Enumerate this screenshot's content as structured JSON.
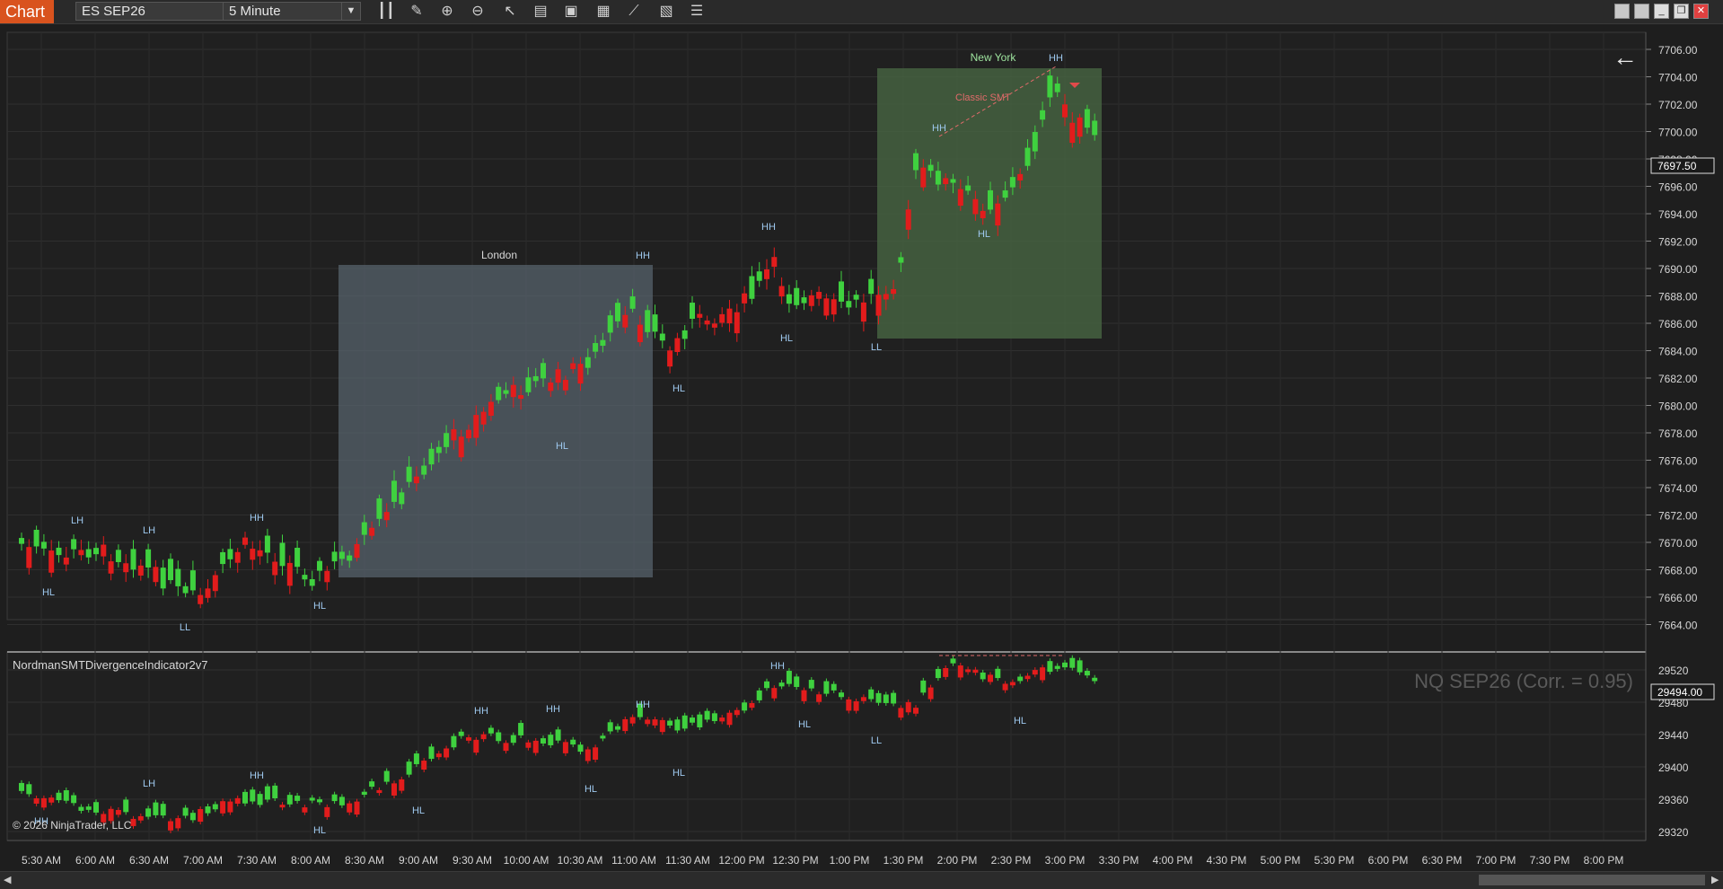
{
  "toolbar": {
    "tab_label": "Chart",
    "instrument": "ES SEP26",
    "interval": "5 Minute",
    "tools": [
      "bar-chart-icon",
      "pencil-icon",
      "zoom-in-icon",
      "zoom-out-icon",
      "pointer-icon",
      "properties-icon",
      "template-icon",
      "strategies-icon",
      "indicators-icon",
      "data-box-icon",
      "menu-icon"
    ],
    "window_buttons": [
      "▫",
      "▫",
      "_",
      "❐",
      "✕"
    ]
  },
  "main_panel": {
    "price_axis": [
      "7706.00",
      "7704.00",
      "7702.00",
      "7700.00",
      "7698.00",
      "7696.00",
      "7694.00",
      "7692.00",
      "7690.00",
      "7688.00",
      "7686.00",
      "7684.00",
      "7682.00",
      "7680.00",
      "7678.00",
      "7676.00",
      "7674.00",
      "7672.00",
      "7670.00",
      "7668.00",
      "7666.00",
      "7664.00"
    ],
    "current_price": "7697.50",
    "sessions": {
      "london": "London",
      "new_york": "New York"
    },
    "annotation": "Classic SMT",
    "swing_labels": [
      "LH",
      "HL",
      "LH",
      "LL",
      "HH",
      "HL",
      "HH",
      "HL",
      "HL",
      "HH",
      "HL",
      "LL",
      "HH",
      "HL",
      "HH"
    ]
  },
  "indicator_panel": {
    "name": "NordmanSMTDivergenceIndicator2v7",
    "correlation": "NQ SEP26 (Corr. = 0.95)",
    "price_axis": [
      "29520",
      "29480",
      "29440",
      "29400",
      "29360",
      "29320"
    ],
    "current_price": "29494.00",
    "swing_labels": [
      "HH",
      "LH",
      "HH",
      "HL",
      "HL",
      "HH",
      "HH",
      "HL",
      "HH",
      "HL",
      "HH",
      "HL",
      "LL",
      "HL"
    ]
  },
  "time_axis": [
    "5:30 AM",
    "6:00 AM",
    "6:30 AM",
    "7:00 AM",
    "7:30 AM",
    "8:00 AM",
    "8:30 AM",
    "9:00 AM",
    "9:30 AM",
    "10:00 AM",
    "10:30 AM",
    "11:00 AM",
    "11:30 AM",
    "12:00 PM",
    "12:30 PM",
    "1:00 PM",
    "1:30 PM",
    "2:00 PM",
    "2:30 PM",
    "3:00 PM",
    "3:30 PM",
    "4:00 PM",
    "4:30 PM",
    "5:00 PM",
    "5:30 PM",
    "6:00 PM",
    "6:30 PM",
    "7:00 PM",
    "7:30 PM",
    "8:00 PM"
  ],
  "copyright": "© 2026 NinjaTrader, LLC",
  "colors": {
    "up": "#3fd13f",
    "down": "#e21c1c",
    "accent": "#d9531e",
    "london_box": "#5a6670",
    "ny_box": "#4a6a44"
  }
}
